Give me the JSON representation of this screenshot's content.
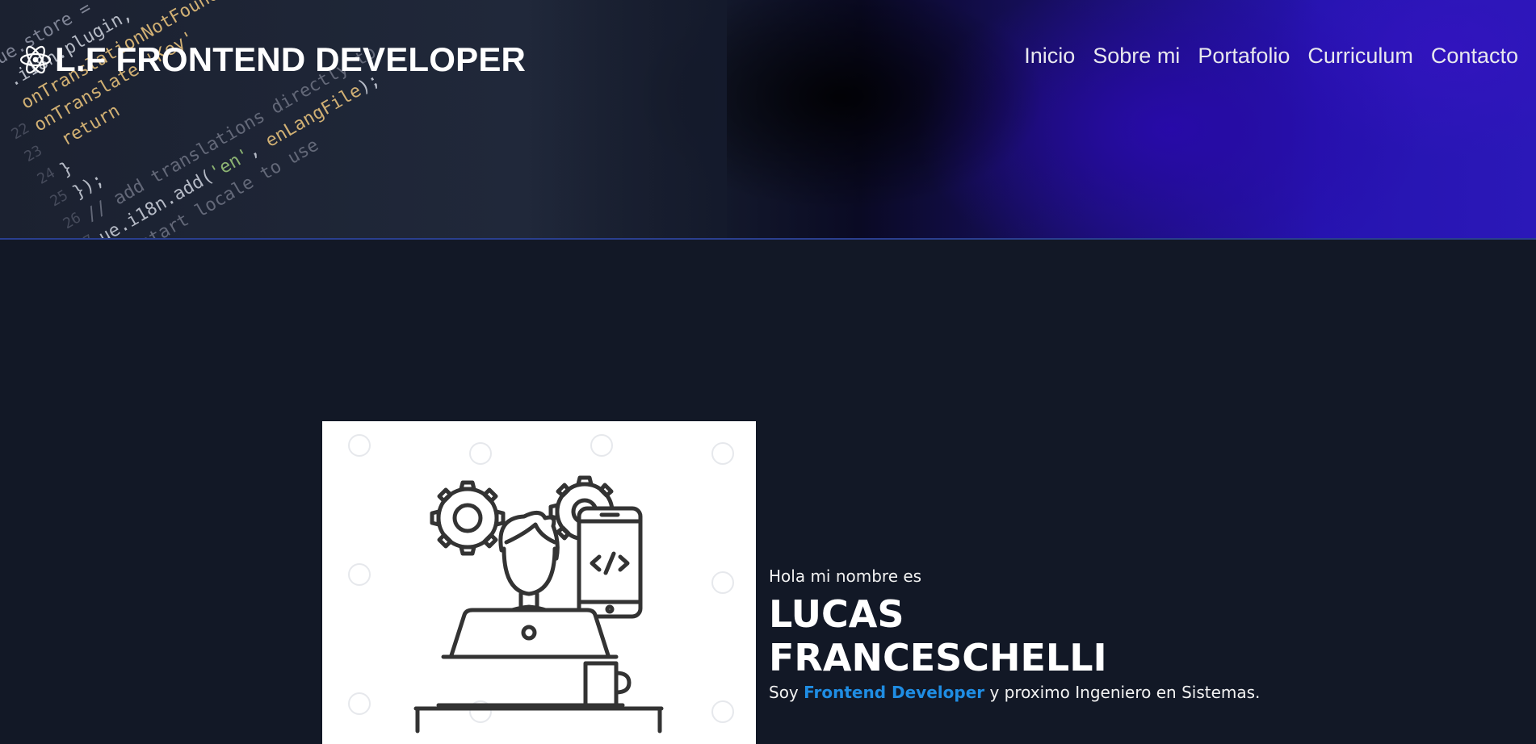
{
  "header": {
    "brand": {
      "icon": "atom-icon",
      "title": "L.F FRONTEND DEVELOPER"
    },
    "nav": [
      {
        "label": "Inicio"
      },
      {
        "label": "Sobre mi"
      },
      {
        "label": "Portafolio"
      },
      {
        "label": "Curriculum"
      },
      {
        "label": "Contacto"
      }
    ],
    "hero_image": "code-on-laptop-background"
  },
  "presentation": {
    "image": "developer-with-laptop-illustration",
    "greeting": "Hola mi nombre es",
    "name_first": "LUCAS",
    "name_last": "FRANCESCHELLI",
    "tagline_prefix": "Soy",
    "tagline_highlight": "Frontend Developer",
    "tagline_suffix": "y proximo Ingeniero en Sistemas."
  },
  "colors": {
    "background": "#121826",
    "accent": "#1f8de3",
    "header_border": "#2a3f8f",
    "text": "#ffffff"
  }
}
